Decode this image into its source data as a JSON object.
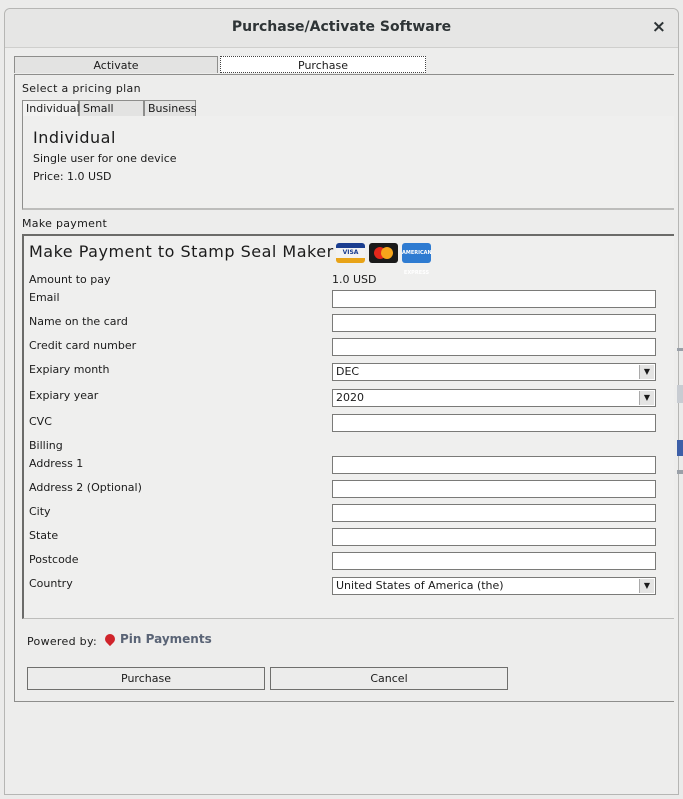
{
  "window": {
    "title": "Purchase/Activate Software",
    "close_icon": "×"
  },
  "outer_tabs": [
    {
      "label": "Activate",
      "active": false
    },
    {
      "label": "Purchase",
      "active": true
    }
  ],
  "pricing": {
    "section_label": "Select a pricing plan",
    "tabs": [
      {
        "label": "Individual",
        "active": true
      },
      {
        "label": "Small Team",
        "active": false
      },
      {
        "label": "Business",
        "active": false
      }
    ],
    "plan_title": "Individual",
    "plan_desc": "Single user for one device",
    "plan_price": "Price: 1.0 USD"
  },
  "payment": {
    "section_label": "Make payment",
    "title": "Make Payment to Stamp Seal Maker",
    "cards": {
      "visa": "VISA",
      "mastercard": "MasterCard",
      "amex": "AMERICAN EXPRESS"
    },
    "amount_label": "Amount to pay",
    "amount_value": "1.0 USD",
    "email_label": "Email",
    "email_value": "",
    "name_label": "Name on the card",
    "name_value": "",
    "ccn_label": "Credit card number",
    "ccn_value": "",
    "exp_month_label": "Expiary month",
    "exp_month_value": "DEC",
    "exp_year_label": "Expiary year",
    "exp_year_value": "2020",
    "cvc_label": "CVC",
    "cvc_value": "",
    "billing_label": "Billing",
    "addr1_label": "Address 1",
    "addr1_value": "",
    "addr2_label": "Address 2 (Optional)",
    "addr2_value": "",
    "city_label": "City",
    "city_value": "",
    "state_label": "State",
    "state_value": "",
    "postcode_label": "Postcode",
    "postcode_value": "",
    "country_label": "Country",
    "country_value": "United States of America (the)"
  },
  "footer": {
    "powered_by": "Powered by:",
    "provider": "Pin Payments",
    "purchase_button": "Purchase",
    "cancel_button": "Cancel"
  }
}
